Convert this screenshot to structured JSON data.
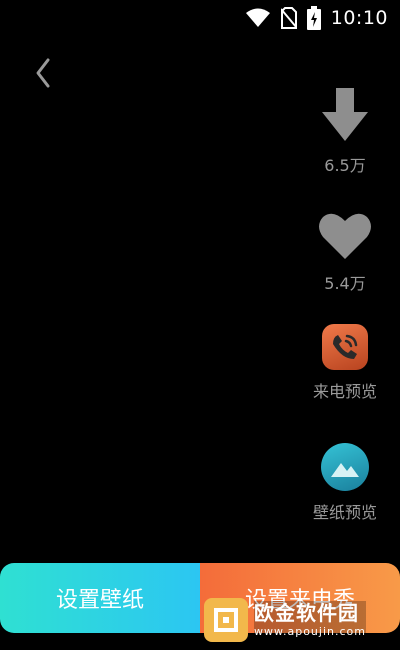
{
  "status_bar": {
    "time": "10:10",
    "icons": [
      "wifi-icon",
      "no-sim-icon",
      "battery-charging-icon"
    ]
  },
  "header": {
    "back_icon": "chevron-left-icon"
  },
  "side_actions": {
    "download": {
      "icon": "download-arrow-icon",
      "label": "6.5万"
    },
    "like": {
      "icon": "heart-icon",
      "label": "5.4万"
    },
    "call_preview": {
      "icon": "phone-call-icon",
      "label": "来电预览",
      "color": "#e8663a"
    },
    "wallpaper_preview": {
      "icon": "landscape-icon",
      "label": "壁纸预览",
      "color": "#2aa6c0"
    }
  },
  "bottom": {
    "set_wallpaper": "设置壁纸",
    "set_callshow": "设置来电秀"
  },
  "watermark": {
    "title": "欧金软件园",
    "url": "www.apoujin.com"
  }
}
